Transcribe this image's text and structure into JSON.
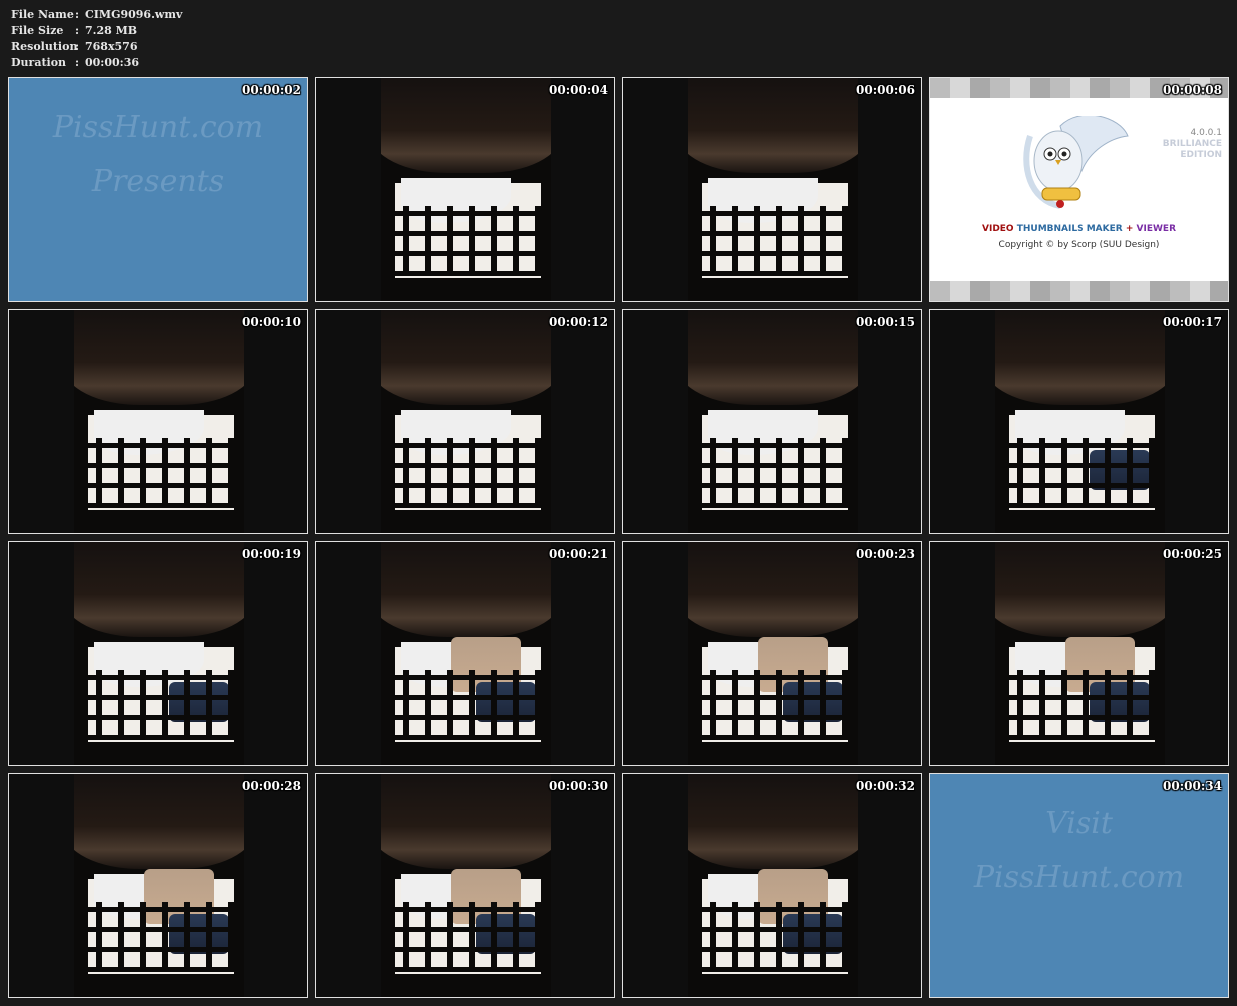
{
  "file_info": {
    "file_name_label": "File Name",
    "file_name": "CIMG9096.wmv",
    "file_size_label": "File Size",
    "file_size": "7.28 MB",
    "resolution_label": "Resolution",
    "resolution": "768x576",
    "duration_label": "Duration",
    "duration": "00:00:36",
    "colon": ":"
  },
  "thumbnails": [
    {
      "time": "00:00:02",
      "kind": "title-card",
      "text1": "PissHunt.com",
      "text2": "Presents"
    },
    {
      "time": "00:00:04",
      "kind": "scene"
    },
    {
      "time": "00:00:06",
      "kind": "scene"
    },
    {
      "time": "00:00:08",
      "kind": "splash"
    },
    {
      "time": "00:00:10",
      "kind": "scene"
    },
    {
      "time": "00:00:12",
      "kind": "scene"
    },
    {
      "time": "00:00:15",
      "kind": "scene"
    },
    {
      "time": "00:00:17",
      "kind": "scene"
    },
    {
      "time": "00:00:19",
      "kind": "scene"
    },
    {
      "time": "00:00:21",
      "kind": "scene"
    },
    {
      "time": "00:00:23",
      "kind": "scene"
    },
    {
      "time": "00:00:25",
      "kind": "scene"
    },
    {
      "time": "00:00:28",
      "kind": "scene"
    },
    {
      "time": "00:00:30",
      "kind": "scene"
    },
    {
      "time": "00:00:32",
      "kind": "scene"
    },
    {
      "time": "00:00:34",
      "kind": "title-card",
      "text1": "Visit",
      "text2": "PissHunt.com"
    }
  ],
  "splash": {
    "version": "4.0.0.1",
    "edition_line1": "BRILLIANCE",
    "edition_line2": "EDITION",
    "title_part1": "VIDEO",
    "title_part2": "THUMBNAILS MAKER",
    "title_plus": "+",
    "title_part3": "VIEWER",
    "copyright": "Copyright © by Scorp (SUU Design)"
  },
  "colors": {
    "background": "#1a1a1a",
    "title_card_blue": "#4e86b4",
    "border": "#e0e0e0"
  }
}
